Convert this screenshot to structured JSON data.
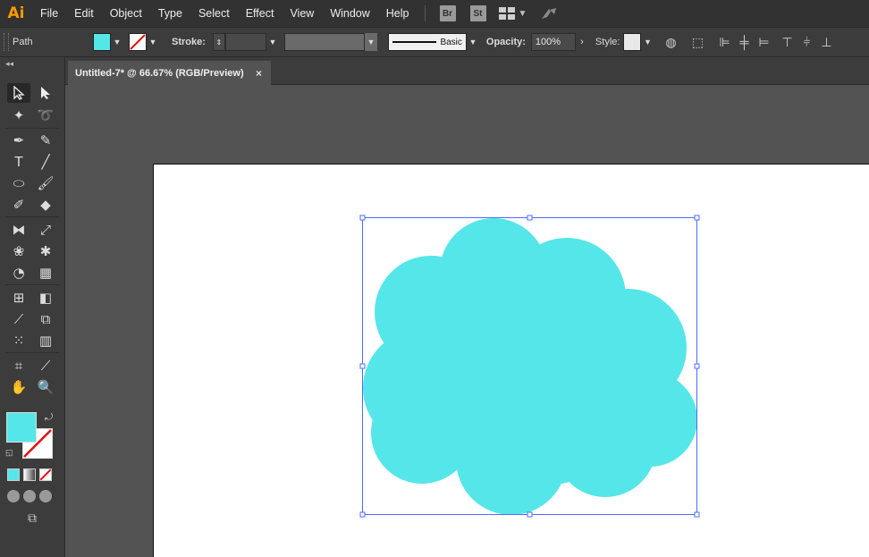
{
  "app": {
    "logo": "Ai"
  },
  "menu": [
    "File",
    "Edit",
    "Object",
    "Type",
    "Select",
    "Effect",
    "View",
    "Window",
    "Help"
  ],
  "menubar_icons": {
    "bridge": "Br",
    "stock": "St"
  },
  "control": {
    "selection_type": "Path",
    "stroke_label": "Stroke:",
    "brush_name": "Basic",
    "opacity_label": "Opacity:",
    "opacity_value": "100%",
    "style_label": "Style:"
  },
  "document": {
    "tab_title": "Untitled-7* @ 66.67% (RGB/Preview)",
    "close": "×"
  },
  "colors": {
    "fill": "#55e6e9",
    "selection": "#4a6cff",
    "stroke": "none"
  },
  "tools": [
    "selection-tool",
    "direct-selection-tool",
    "magic-wand-tool",
    "lasso-tool",
    "pen-tool",
    "curvature-tool",
    "type-tool",
    "line-segment-tool",
    "ellipse-tool",
    "paintbrush-tool",
    "shaper-tool",
    "eraser-tool",
    "reflect-tool",
    "scale-tool",
    "warp-tool",
    "free-transform-tool",
    "shape-builder-tool",
    "perspective-grid-tool",
    "mesh-tool",
    "gradient-tool",
    "eyedropper-tool",
    "blend-tool",
    "symbol-sprayer-tool",
    "column-graph-tool",
    "artboard-tool",
    "slice-tool",
    "hand-tool",
    "zoom-tool"
  ]
}
